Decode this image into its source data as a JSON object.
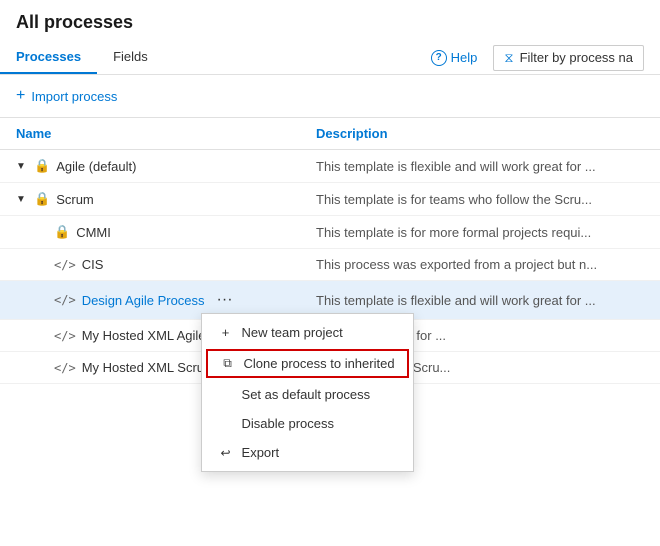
{
  "page": {
    "title": "All processes",
    "tabs": [
      {
        "id": "processes",
        "label": "Processes",
        "active": true
      },
      {
        "id": "fields",
        "label": "Fields",
        "active": false
      }
    ],
    "help_label": "Help",
    "filter_placeholder": "Filter by process na",
    "import_btn": "Import process",
    "columns": [
      {
        "id": "name",
        "label": "Name"
      },
      {
        "id": "description",
        "label": "Description"
      }
    ],
    "rows": [
      {
        "id": "agile",
        "indent": 1,
        "chevron": "▼",
        "icon": "lock",
        "name": "Agile (default)",
        "link": false,
        "description": "This template is flexible and will work great for ..."
      },
      {
        "id": "scrum",
        "indent": 1,
        "chevron": "▼",
        "icon": "lock",
        "name": "Scrum",
        "link": false,
        "description": "This template is for teams who follow the Scru..."
      },
      {
        "id": "cmmi",
        "indent": 2,
        "chevron": "",
        "icon": "lock",
        "name": "CMMI",
        "link": false,
        "description": "This template is for more formal projects requi..."
      },
      {
        "id": "cis",
        "indent": 2,
        "chevron": "",
        "icon": "code",
        "name": "CIS",
        "link": false,
        "description": "This process was exported from a project but n..."
      },
      {
        "id": "design-agile",
        "indent": 2,
        "chevron": "",
        "icon": "code",
        "name": "Design Agile Process",
        "link": true,
        "selected": true,
        "description": "This template is flexible and will work great for ..."
      },
      {
        "id": "my-hosted-xml-agile",
        "indent": 2,
        "chevron": "",
        "icon": "code",
        "name": "My Hosted XML Agile",
        "link": false,
        "description": "... will work great for ..."
      },
      {
        "id": "my-hosted-xml-scrum",
        "indent": 2,
        "chevron": "",
        "icon": "code",
        "name": "My Hosted XML Scrum",
        "link": false,
        "description": "...who follow the Scru..."
      }
    ],
    "context_menu": {
      "items": [
        {
          "id": "new-team-project",
          "icon": "+",
          "label": "New team project",
          "highlighted": false
        },
        {
          "id": "clone-process",
          "icon": "clone",
          "label": "Clone process to inherited",
          "highlighted": true
        },
        {
          "id": "set-default",
          "icon": "",
          "label": "Set as default process",
          "highlighted": false
        },
        {
          "id": "disable-process",
          "icon": "",
          "label": "Disable process",
          "highlighted": false
        },
        {
          "id": "export",
          "icon": "export",
          "label": "Export",
          "highlighted": false
        }
      ]
    }
  }
}
